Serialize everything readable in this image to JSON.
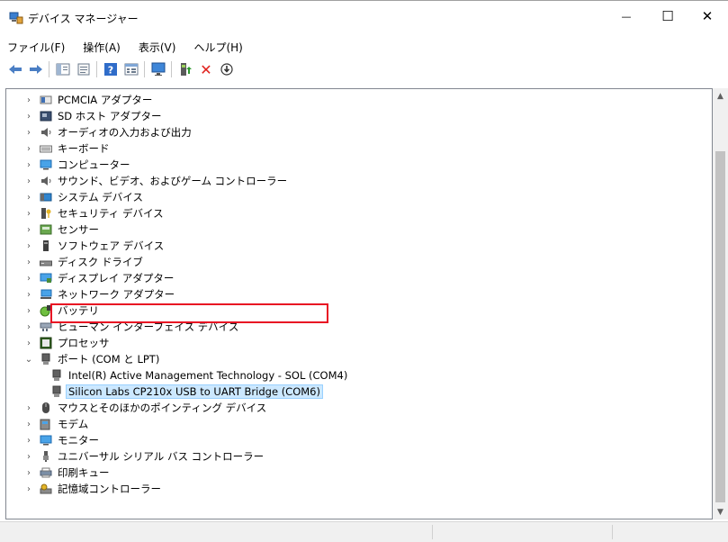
{
  "window": {
    "title": "デバイス マネージャー",
    "minimize_icon": "—",
    "maximize_icon": "☐",
    "close_icon": "✕"
  },
  "menu": [
    "ファイル(F)",
    "操作(A)",
    "表示(V)",
    "ヘルプ(H)"
  ],
  "toolbar": {
    "back_icon": "back-arrow",
    "forward_icon": "forward-arrow",
    "remove_glyph": "✕",
    "download_glyph": "⊕"
  },
  "tree": {
    "items": [
      {
        "label": "PCMCIA アダプター",
        "expanded": false
      },
      {
        "label": "SD ホスト アダプター",
        "expanded": false
      },
      {
        "label": "オーディオの入力および出力",
        "expanded": false
      },
      {
        "label": "キーボード",
        "expanded": false
      },
      {
        "label": "コンピューター",
        "expanded": false
      },
      {
        "label": "サウンド、ビデオ、およびゲーム コントローラー",
        "expanded": false
      },
      {
        "label": "システム デバイス",
        "expanded": false
      },
      {
        "label": "セキュリティ デバイス",
        "expanded": false
      },
      {
        "label": "センサー",
        "expanded": false
      },
      {
        "label": "ソフトウェア デバイス",
        "expanded": false
      },
      {
        "label": "ディスク ドライブ",
        "expanded": false
      },
      {
        "label": "ディスプレイ アダプター",
        "expanded": false
      },
      {
        "label": "ネットワーク アダプター",
        "expanded": false
      },
      {
        "label": "バッテリ",
        "expanded": false
      },
      {
        "label": "ヒューマン インターフェイス デバイス",
        "expanded": false
      },
      {
        "label": "プロセッサ",
        "expanded": false
      },
      {
        "label": "ポート (COM と LPT)",
        "expanded": true
      },
      {
        "label": "Intel(R) Active Management Technology - SOL (COM4)",
        "child": true
      },
      {
        "label": "Silicon Labs CP210x USB to UART Bridge (COM6)",
        "child": true,
        "selected": true
      },
      {
        "label": "マウスとそのほかのポインティング デバイス",
        "expanded": false
      },
      {
        "label": "モデム",
        "expanded": false
      },
      {
        "label": "モニター",
        "expanded": false
      },
      {
        "label": "ユニバーサル シリアル バス コントローラー",
        "expanded": false
      },
      {
        "label": "印刷キュー",
        "expanded": false
      },
      {
        "label": "記憶域コントローラー",
        "expanded": false
      }
    ],
    "collapsed_glyph": "›",
    "expanded_glyph": "⌄"
  },
  "colors": {
    "highlight_border": "#e81123",
    "selection_bg": "#cce8ff"
  }
}
